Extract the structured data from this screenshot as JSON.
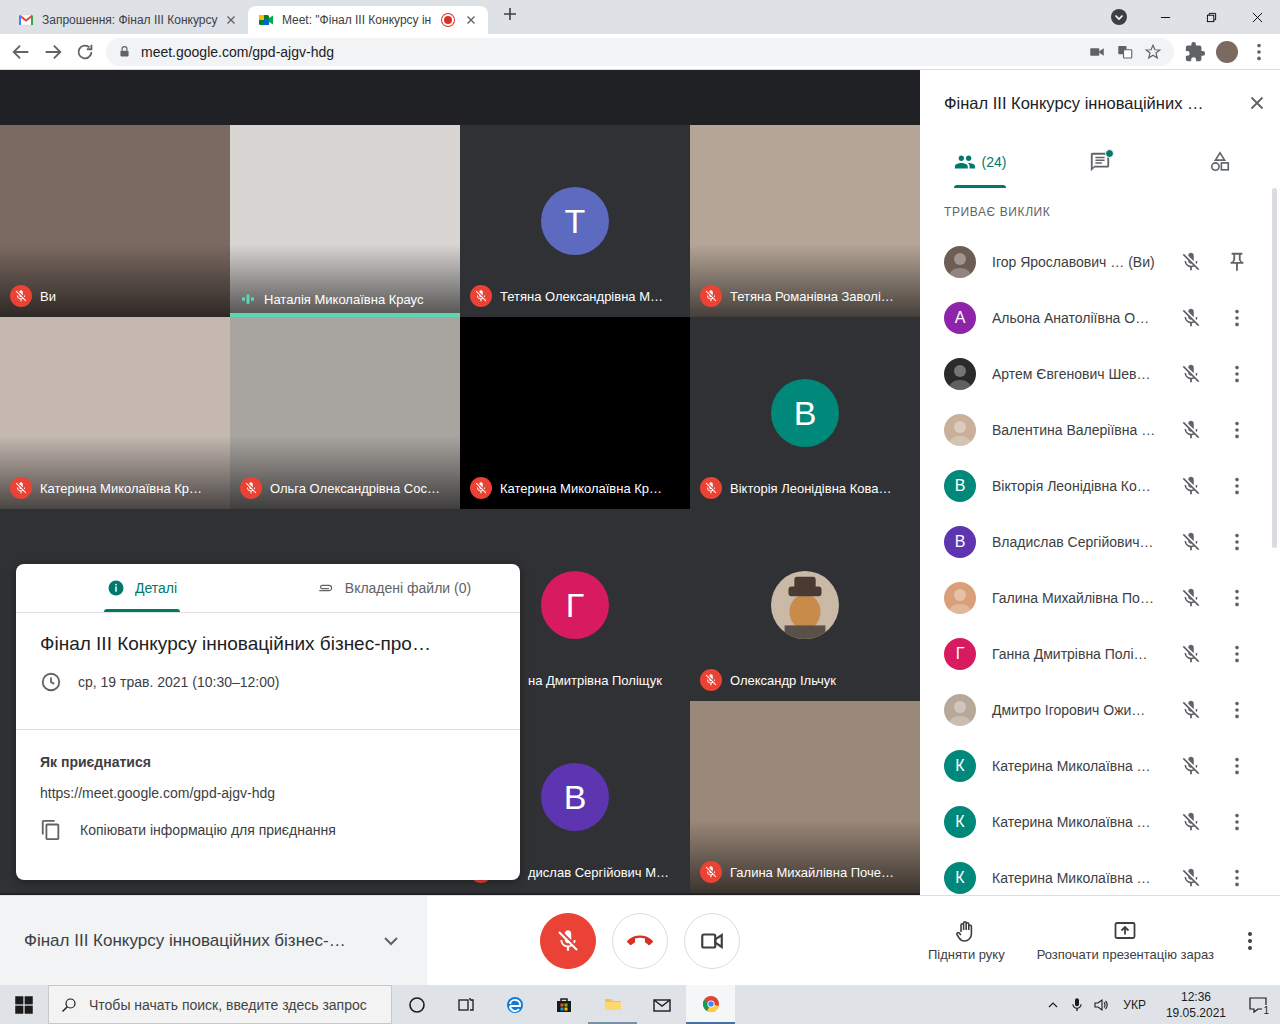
{
  "browser": {
    "tabs": [
      {
        "label": "Запрошення: Фінал III Конкурсу",
        "selected": false,
        "recording": false
      },
      {
        "label": "Meet: \"Фінал III Конкурсу ін",
        "selected": true,
        "recording": true
      }
    ],
    "url": "meet.google.com/gpd-ajgv-hdg"
  },
  "tiles": [
    {
      "name": "Ви",
      "kind": "video",
      "muted": true,
      "speaking": false,
      "covered": false,
      "color": "#7b6a62"
    },
    {
      "name": "Наталія Миколаївна Краус",
      "kind": "video",
      "muted": false,
      "speaking": true,
      "covered": false,
      "color": "#d8d5d3"
    },
    {
      "name": "Тетяна Олександрівна М…",
      "kind": "letter",
      "letter": "Т",
      "muted": true,
      "speaking": false,
      "covered": false,
      "color": "#5c6bc0"
    },
    {
      "name": "Тетяна Романівна Заволі…",
      "kind": "video",
      "muted": true,
      "speaking": false,
      "covered": false,
      "color": "#b5a597"
    },
    {
      "name": "Катерина Миколаївна Кр…",
      "kind": "video",
      "muted": true,
      "speaking": false,
      "covered": false,
      "color": "#c4b8b0"
    },
    {
      "name": "Ольга Олександрівна Сос…",
      "kind": "video",
      "muted": true,
      "speaking": false,
      "covered": false,
      "color": "#a8a4a0"
    },
    {
      "name": "Катерина Миколаївна Кр…",
      "kind": "video",
      "muted": true,
      "speaking": false,
      "covered": false,
      "color": "#000000"
    },
    {
      "name": "Вікторія Леонідівна Кова…",
      "kind": "letter",
      "letter": "В",
      "muted": true,
      "speaking": false,
      "covered": false,
      "color": "#00897b"
    },
    {
      "kind": "hidden"
    },
    {
      "kind": "hidden"
    },
    {
      "name": "на Дмитрівна Поліщук",
      "kind": "letter",
      "letter": "Г",
      "muted": true,
      "speaking": false,
      "covered": true,
      "color": "#d81b60"
    },
    {
      "name": "Олександр Ільчук",
      "kind": "photo",
      "muted": true,
      "speaking": false,
      "covered": false,
      "color": "#c9b9a6"
    },
    {
      "kind": "hidden"
    },
    {
      "kind": "hidden"
    },
    {
      "name": "дислав Сергійович М…",
      "kind": "letter",
      "letter": "В",
      "muted": true,
      "speaking": false,
      "covered": true,
      "color": "#5e35b1"
    },
    {
      "name": "Галина Михайлівна Поче…",
      "kind": "video",
      "muted": true,
      "speaking": false,
      "covered": false,
      "color": "#9a8878"
    }
  ],
  "details": {
    "tabs": [
      {
        "label": "Деталі",
        "kind": "info",
        "selected": true
      },
      {
        "label": "Вкладені файли (0)",
        "kind": "attachment",
        "selected": false
      }
    ],
    "title": "Фінал III Конкурсу інноваційних бізнес-про…",
    "time": "ср, 19 трав. 2021 (10:30–12:00)",
    "join_heading": "Як приєднатися",
    "join_link": "https://meet.google.com/gpd-ajgv-hdg",
    "copy_label": "Копіювати інформацію для приєднання"
  },
  "panel": {
    "title": "Фінал III Конкурсу інноваційних …",
    "tabs": [
      {
        "kind": "people",
        "label": "(24)",
        "selected": true,
        "unread": false
      },
      {
        "kind": "chat",
        "label": "",
        "selected": false,
        "unread": true
      },
      {
        "kind": "activities",
        "label": "",
        "selected": false,
        "unread": false
      }
    ],
    "section": "ТРИВАЄ ВИКЛИК",
    "participants": [
      {
        "name": "Ігор Ярославович … (Ви)",
        "kind": "photo",
        "color": "#6d5d55",
        "muted": true,
        "self": true
      },
      {
        "name": "Альона Анатоліївна О…",
        "kind": "letter",
        "letter": "А",
        "color": "#8e24aa",
        "muted": true,
        "self": false
      },
      {
        "name": "Артем Євгенович Шев…",
        "kind": "photo",
        "color": "#2b2b2b",
        "muted": true,
        "self": false
      },
      {
        "name": "Валентина Валеріївна …",
        "kind": "photo",
        "color": "#c9b09a",
        "muted": true,
        "self": false
      },
      {
        "name": "Вікторія Леонідівна Ко…",
        "kind": "letter",
        "letter": "В",
        "color": "#00897b",
        "muted": true,
        "self": false
      },
      {
        "name": "Владислав Сергійович…",
        "kind": "letter",
        "letter": "В",
        "color": "#5e35b1",
        "muted": true,
        "self": false
      },
      {
        "name": "Галина Михайлівна По…",
        "kind": "photo",
        "color": "#d9a07a",
        "muted": true,
        "self": false
      },
      {
        "name": "Ганна Дмитрівна Полі…",
        "kind": "letter",
        "letter": "Г",
        "color": "#d81b60",
        "muted": true,
        "self": false
      },
      {
        "name": "Дмитро Ігорович Ожи…",
        "kind": "photo",
        "color": "#b8a89a",
        "muted": true,
        "self": false
      },
      {
        "name": "Катерина Миколаївна …",
        "kind": "letter",
        "letter": "К",
        "color": "#00897b",
        "muted": true,
        "self": false
      },
      {
        "name": "Катерина Миколаївна …",
        "kind": "letter",
        "letter": "К",
        "color": "#00897b",
        "muted": true,
        "self": false
      },
      {
        "name": "Катерина Миколаївна …",
        "kind": "letter",
        "letter": "К",
        "color": "#00897b",
        "muted": true,
        "self": false
      }
    ]
  },
  "controls": {
    "title": "Фінал III Конкурсу інноваційних бізнес-…",
    "mic_muted": true,
    "camera_on": true,
    "raise_hand": "Підняти руку",
    "present": "Розпочати презентацію зараз"
  },
  "taskbar": {
    "search_placeholder": "Чтобы начать поиск, введите здесь запрос",
    "apps": [
      {
        "kind": "edge",
        "running": false,
        "selected": false
      },
      {
        "kind": "store",
        "running": false,
        "selected": false
      },
      {
        "kind": "explorer",
        "running": true,
        "selected": false
      },
      {
        "kind": "mail",
        "running": false,
        "selected": false
      },
      {
        "kind": "chrome",
        "running": true,
        "selected": true
      }
    ],
    "language": "УКР",
    "time": "12:36",
    "date": "19.05.2021",
    "notifications": "1"
  }
}
